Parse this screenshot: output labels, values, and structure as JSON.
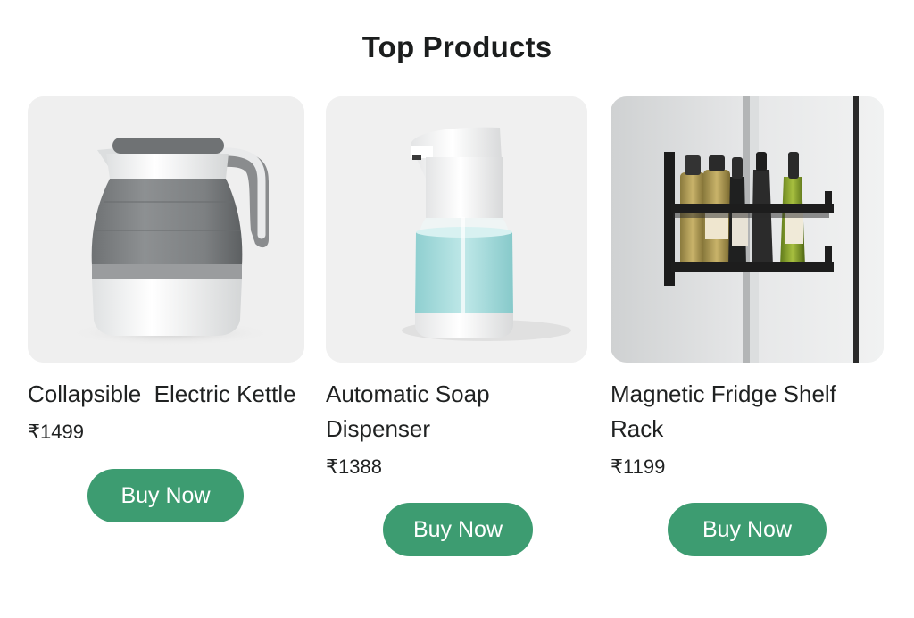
{
  "header": {
    "title": "Top Products"
  },
  "products": [
    {
      "name": "Collapsible  Electric Kettle",
      "price": "₹1499",
      "button_label": "Buy Now",
      "image_icon": "collapsible-kettle-image"
    },
    {
      "name": "Automatic Soap\nDispenser",
      "price": "₹1388",
      "button_label": "Buy Now",
      "image_icon": "soap-dispenser-image"
    },
    {
      "name": "Magnetic Fridge Shelf\nRack",
      "price": "₹1199",
      "button_label": "Buy Now",
      "image_icon": "fridge-shelf-rack-image"
    }
  ],
  "colors": {
    "button_green": "#3d9c71",
    "card_background": "#efefef",
    "text": "#202222"
  }
}
